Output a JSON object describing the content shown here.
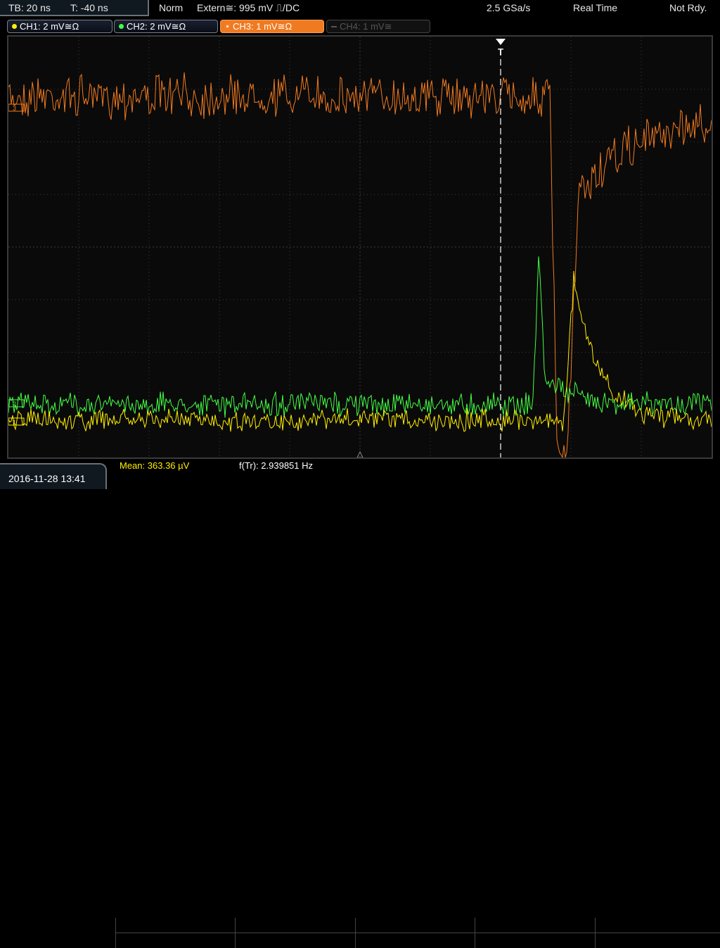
{
  "topbar": {
    "timebase": "TB: 20 ns",
    "trigger_pos": "T: -40 ns",
    "mode": "Norm",
    "trigger_source": "Extern",
    "trigger_level": "995 mV",
    "trigger_coupling": "DC",
    "sample_rate": "2.5 GSa/s",
    "acq_mode": "Real Time",
    "status": "Not Rdy."
  },
  "channels": [
    {
      "label": "CH1: 2 mV",
      "suffix": "≅Ω",
      "color": "#ffee00",
      "state": "on"
    },
    {
      "label": "CH2: 2 mV",
      "suffix": "≅Ω",
      "color": "#44ff44",
      "state": "on"
    },
    {
      "label": "CH3: 1 mV",
      "suffix": "≅Ω",
      "color": "#f07a20",
      "state": "active"
    },
    {
      "label": "CH4: 1 mV",
      "suffix": "≅",
      "color": "#555555",
      "state": "off"
    }
  ],
  "markers": {
    "ch3": "3",
    "ch2": "2",
    "ch1": "1",
    "trigger": "T"
  },
  "bottom": {
    "datetime": "2016-11-28 13:41",
    "mean_label": "Mean:",
    "mean_value": "363.36 µV",
    "freq_label": "f(Tr):",
    "freq_value": "2.939851 Hz"
  },
  "colors": {
    "ch1": "#ffee00",
    "ch2": "#44ff44",
    "ch3": "#f07a20",
    "grid": "#3c3c3c",
    "mean": "#ffee00"
  }
}
